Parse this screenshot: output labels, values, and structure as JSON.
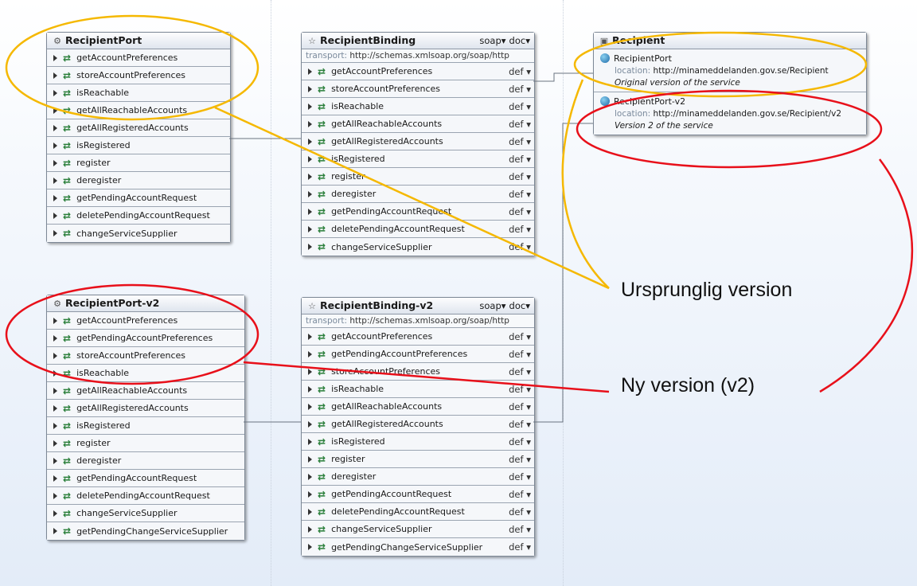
{
  "port_v1": {
    "title": "RecipientPort",
    "icon": "port-icon",
    "operations": [
      "getAccountPreferences",
      "storeAccountPreferences",
      "isReachable",
      "getAllReachableAccounts",
      "getAllRegisteredAccounts",
      "isRegistered",
      "register",
      "deregister",
      "getPendingAccountRequest",
      "deletePendingAccountRequest",
      "changeServiceSupplier"
    ]
  },
  "binding_v1": {
    "title": "RecipientBinding",
    "icon": "binding-icon",
    "style": "soap",
    "use": "doc",
    "transport_label": "transport:",
    "transport_value": "http://schemas.xmlsoap.org/soap/http",
    "op_suffix": "def",
    "operations": [
      "getAccountPreferences",
      "storeAccountPreferences",
      "isReachable",
      "getAllReachableAccounts",
      "getAllRegisteredAccounts",
      "isRegistered",
      "register",
      "deregister",
      "getPendingAccountRequest",
      "deletePendingAccountRequest",
      "changeServiceSupplier"
    ]
  },
  "port_v2": {
    "title": "RecipientPort-v2",
    "icon": "port-icon",
    "operations": [
      "getAccountPreferences",
      "getPendingAccountPreferences",
      "storeAccountPreferences",
      "isReachable",
      "getAllReachableAccounts",
      "getAllRegisteredAccounts",
      "isRegistered",
      "register",
      "deregister",
      "getPendingAccountRequest",
      "deletePendingAccountRequest",
      "changeServiceSupplier",
      "getPendingChangeServiceSupplier"
    ]
  },
  "binding_v2": {
    "title": "RecipientBinding-v2",
    "icon": "binding-icon",
    "style": "soap",
    "use": "doc",
    "transport_label": "transport:",
    "transport_value": "http://schemas.xmlsoap.org/soap/http",
    "op_suffix": "def",
    "operations": [
      "getAccountPreferences",
      "getPendingAccountPreferences",
      "storeAccountPreferences",
      "isReachable",
      "getAllReachableAccounts",
      "getAllRegisteredAccounts",
      "isRegistered",
      "register",
      "deregister",
      "getPendingAccountRequest",
      "deletePendingAccountRequest",
      "changeServiceSupplier",
      "getPendingChangeServiceSupplier"
    ]
  },
  "service": {
    "title": "Recipient",
    "icon": "service-icon",
    "ports": [
      {
        "name": "RecipientPort",
        "location_label": "location:",
        "location": "http://minameddelanden.gov.se/Recipient",
        "doc": "Original version of the service"
      },
      {
        "name": "RecipientPort-v2",
        "location_label": "location:",
        "location": "http://minameddelanden.gov.se/Recipient/v2",
        "doc": "Version 2 of the service"
      }
    ]
  },
  "annotations": {
    "original": "Ursprunglig version",
    "new": "Ny version (v2)"
  },
  "colors": {
    "original_highlight": "#f5b800",
    "new_highlight": "#e8101a"
  }
}
